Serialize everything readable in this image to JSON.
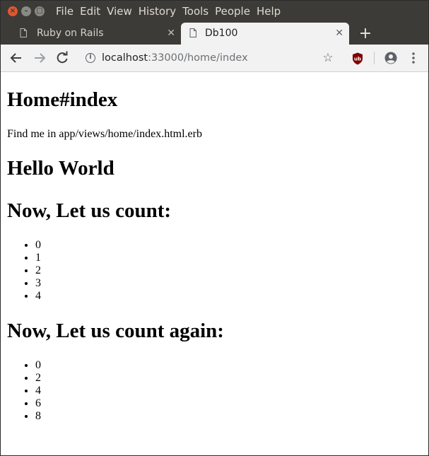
{
  "window": {
    "menu": [
      "File",
      "Edit",
      "View",
      "History",
      "Tools",
      "People",
      "Help"
    ]
  },
  "tabs": [
    {
      "title": "Ruby on Rails",
      "active": false
    },
    {
      "title": "Db100",
      "active": true
    }
  ],
  "toolbar": {
    "url_host": "localhost",
    "url_rest": ":33000/home/index"
  },
  "page": {
    "heading": "Home#index",
    "note": "Find me in app/views/home/index.html.erb",
    "hello": "Hello World",
    "count_heading": "Now, Let us count:",
    "count_items": [
      "0",
      "1",
      "2",
      "3",
      "4"
    ],
    "count_again_heading": "Now, Let us count again:",
    "count_again_items": [
      "0",
      "2",
      "4",
      "6",
      "8"
    ]
  }
}
